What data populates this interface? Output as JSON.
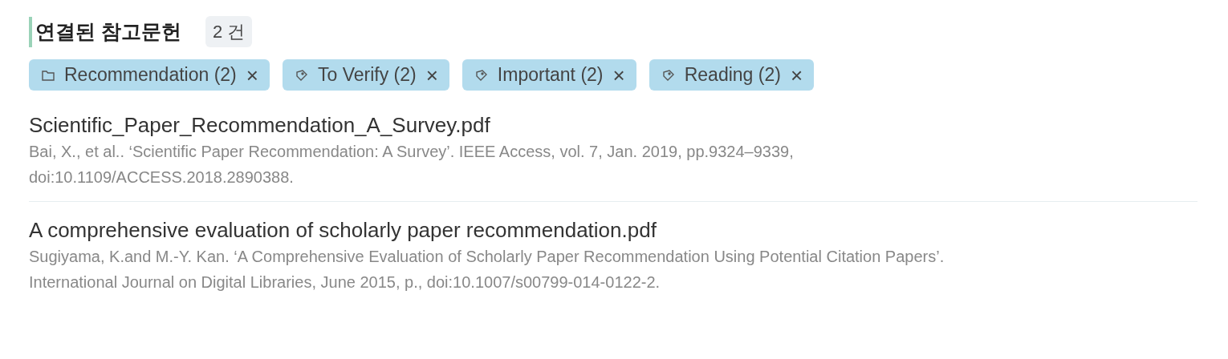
{
  "header": {
    "title": "연결된 참고문헌",
    "count": "2 건"
  },
  "tags": [
    {
      "kind": "folder",
      "label": "Recommendation (2)",
      "remove": "×"
    },
    {
      "kind": "tag",
      "label": "To Verify (2)",
      "remove": "×"
    },
    {
      "kind": "tag",
      "label": "Important (2)",
      "remove": "×"
    },
    {
      "kind": "tag",
      "label": "Reading (2)",
      "remove": "×"
    }
  ],
  "references": [
    {
      "file": "Scientific_Paper_Recommendation_A_Survey.pdf",
      "citation_lines": [
        "Bai, X., et al.. ‘Scientific Paper Recommendation: A Survey’. IEEE Access, vol. 7, Jan. 2019, pp.9324–9339,",
        "doi:10.1109/ACCESS.2018.2890388."
      ]
    },
    {
      "file": "A comprehensive evaluation of scholarly paper recommendation.pdf",
      "citation_lines": [
        "Sugiyama, K.and M.-Y. Kan. ‘A Comprehensive Evaluation of Scholarly Paper Recommendation Using Potential Citation Papers’.",
        "International Journal on Digital Libraries, June 2015, p., doi:10.1007/s00799-014-0122-2."
      ]
    }
  ]
}
